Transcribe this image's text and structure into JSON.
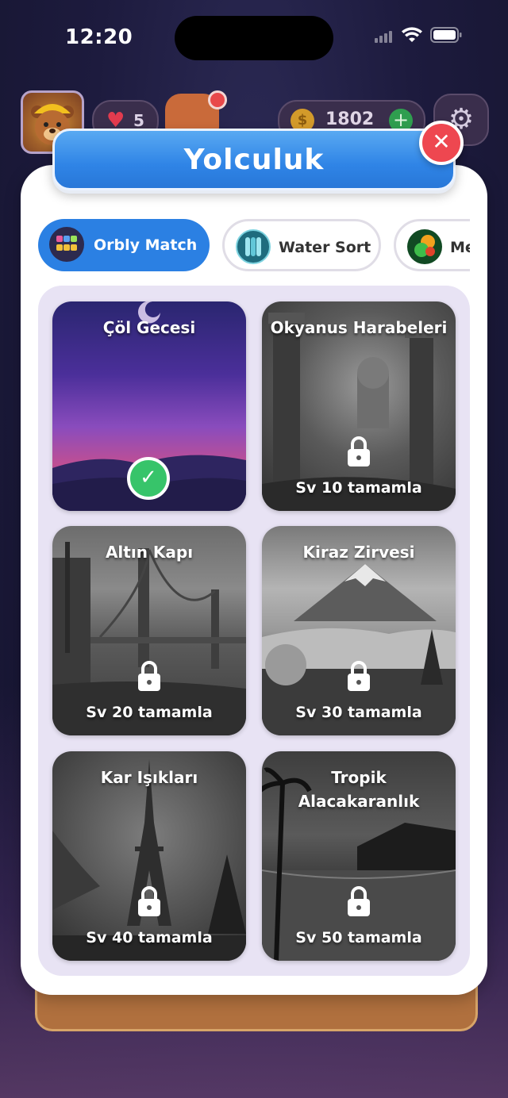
{
  "status": {
    "time": "12:20"
  },
  "hud": {
    "hearts": "5",
    "coins": "1802"
  },
  "modal": {
    "title": "Yolculuk",
    "tabs": [
      {
        "label": "Orbly Match",
        "active": true
      },
      {
        "label": "Water Sort",
        "active": false
      },
      {
        "label": "Me",
        "active": false
      }
    ],
    "cards": [
      {
        "title": "Çöl Gecesi",
        "unlocked": true,
        "requirement": ""
      },
      {
        "title": "Okyanus Harabeleri",
        "unlocked": false,
        "requirement": "Sv 10 tamamla"
      },
      {
        "title": "Altın Kapı",
        "unlocked": false,
        "requirement": "Sv 20 tamamla"
      },
      {
        "title": "Kiraz Zirvesi",
        "unlocked": false,
        "requirement": "Sv 30 tamamla"
      },
      {
        "title": "Kar Işıkları",
        "unlocked": false,
        "requirement": "Sv 40 tamamla"
      },
      {
        "title": "Tropik Alacakaranlık",
        "unlocked": false,
        "requirement": "Sv 50 tamamla"
      }
    ]
  },
  "colors": {
    "accent": "#2b80e3",
    "close": "#ee4750",
    "check": "#37c46a"
  }
}
